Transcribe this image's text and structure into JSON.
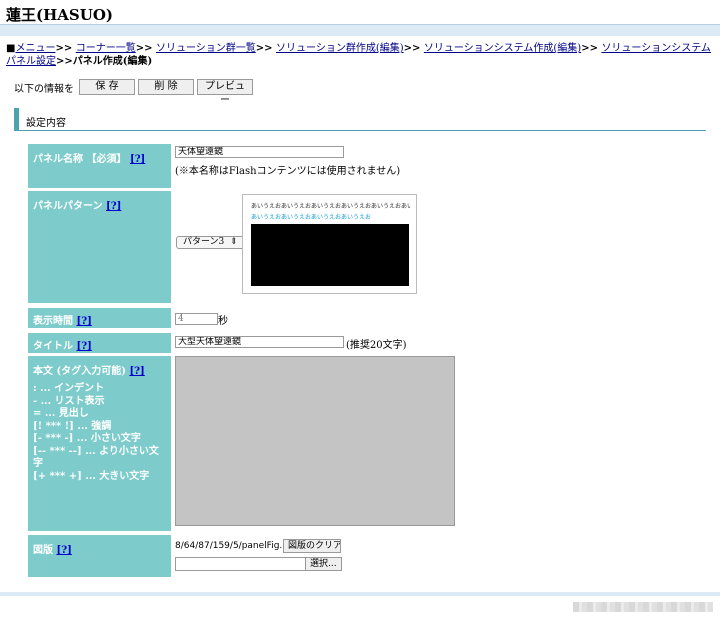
{
  "site": {
    "title": "蓮王(HASUO)"
  },
  "breadcrumb": {
    "prefix": "■",
    "items": [
      "メニュー",
      "コーナー一覧",
      "ソリューション群一覧",
      "ソリューション群作成(編集)",
      "ソリューションシステム作成(編集)",
      "ソリューションシステム パネル設定"
    ],
    "separator": ">>",
    "current": "パネル作成(編集)"
  },
  "actions": {
    "label": "以下の情報を",
    "save": "保 存",
    "delete": "削 除",
    "preview": "プレビュー"
  },
  "section": {
    "title": "設定内容"
  },
  "help_label": "[?]",
  "form": {
    "panel_name": {
      "label": "パネル名称 【必須】",
      "value": "天体望遠鏡",
      "note": "(※本名称はFlashコンテンツには使用されません)"
    },
    "panel_pattern": {
      "label": "パネルパターン",
      "select_value": "パターン3",
      "preview_line1": "あいうえおあいうえおあいうえおあいうえおあいうえおあいうえお",
      "preview_line2": "あいうえおあいうえおあいうえおあいうえお"
    },
    "display_time": {
      "label": "表示時間",
      "value": "4",
      "unit": "秒"
    },
    "title": {
      "label": "タイトル",
      "value": "大型天体望遠鏡",
      "note": "(推奨20文字)"
    },
    "body": {
      "label": "本文 (タグ入力可能)",
      "guide": [
        ": ... インデント",
        "- ... リスト表示",
        "= ... 見出し",
        "[! *** !] ... 強調",
        "[- *** -] ... 小さい文字",
        "[-- *** --] ... より小さい文字",
        "[+ *** +] ... 大きい文字"
      ],
      "value": ""
    },
    "figure": {
      "label": "図版",
      "path": "8/64/87/159/5/panelFig.",
      "clip_button": "図版のクリア",
      "select_button": "選択..."
    }
  },
  "colors": {
    "header_cell": "#7ecbcb",
    "accent": "#4aa3ad",
    "band": "#dceaf6",
    "link": "#000088"
  }
}
